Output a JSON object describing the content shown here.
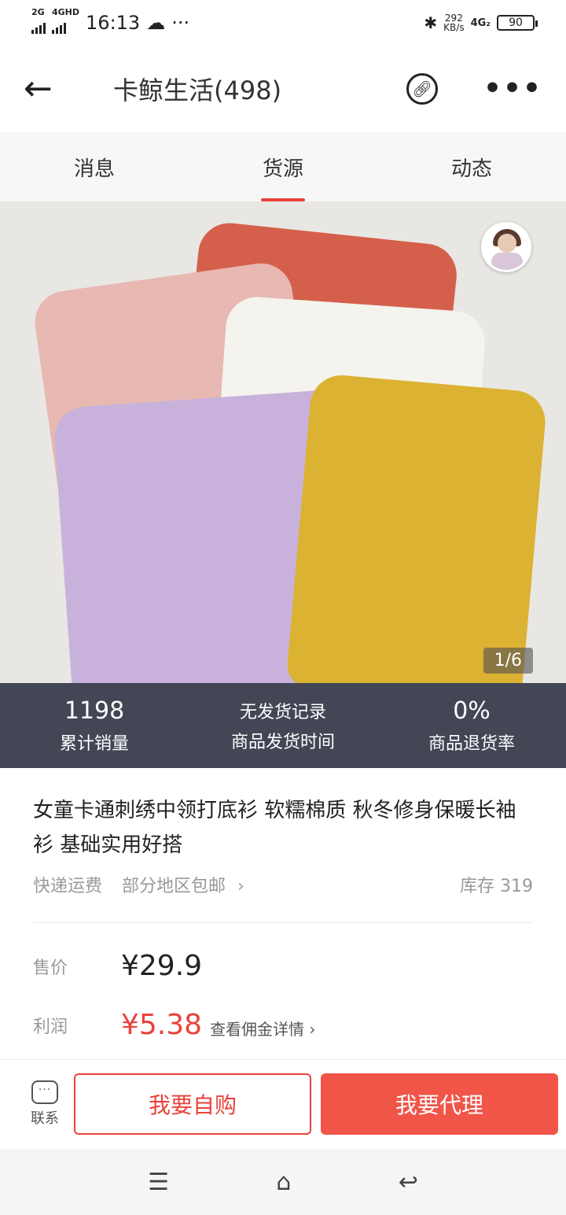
{
  "status": {
    "net1": "2G",
    "net2": "4GHD",
    "time": "16:13",
    "weather_icon": "cloud-icon",
    "dots": "···",
    "speed_value": "292",
    "speed_unit": "KB/s",
    "net3": "4G₂",
    "battery": "90"
  },
  "nav": {
    "back": "←",
    "title": "卡鲸生活(498)",
    "more": "•••"
  },
  "tabs": [
    {
      "label": "消息"
    },
    {
      "label": "货源"
    },
    {
      "label": "动态"
    }
  ],
  "gallery": {
    "counter": "1/6",
    "progress": 1,
    "total": 6
  },
  "stats": [
    {
      "value": "1198",
      "label": "累计销量"
    },
    {
      "value": "无发货记录",
      "label": "商品发货时间"
    },
    {
      "value": "0%",
      "label": "商品退货率"
    }
  ],
  "product": {
    "title": "女童卡通刺绣中领打底衫 软糯棉质 秋冬修身保暖长袖衫  基础实用好搭",
    "ship_label": "快递运费",
    "ship_value": "部分地区包邮",
    "stock": "库存 319",
    "price_label": "售价",
    "price": "¥29.9",
    "profit_label": "利润",
    "profit": "¥5.38",
    "commission_link": "查看佣金详情"
  },
  "bottom": {
    "contact": "联系",
    "buy_self": "我要自购",
    "agent": "我要代理"
  },
  "colors": {
    "accent": "#e9423a",
    "stats_bg": "#434655",
    "agent_btn": "#f05548"
  }
}
